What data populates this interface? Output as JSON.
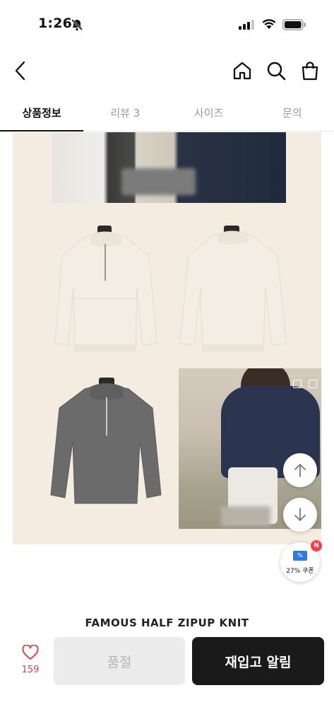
{
  "status_bar": {
    "time": "1:26"
  },
  "tabs": [
    {
      "label": "상품정보"
    },
    {
      "label": "리뷰 3"
    },
    {
      "label": "사이즈"
    },
    {
      "label": "문의"
    }
  ],
  "coupon": {
    "label": "27% 쿠폰",
    "badge": "N"
  },
  "product": {
    "title": "FAMOUS HALF ZIPUP KNIT"
  },
  "bottom_bar": {
    "like_count": "159",
    "soldout_label": "품절",
    "restock_label": "재입고 알림"
  },
  "colors": {
    "accent": "#e33a4a",
    "primary_button": "#1a1a1a",
    "background_beige": "#f4ebe1"
  },
  "icons": [
    "bell-slash-icon",
    "signal-icon",
    "wifi-icon",
    "battery-icon",
    "back-arrow-icon",
    "home-icon",
    "search-icon",
    "shopping-bag-icon",
    "arrow-up-icon",
    "arrow-down-icon",
    "coupon-icon",
    "heart-icon"
  ]
}
